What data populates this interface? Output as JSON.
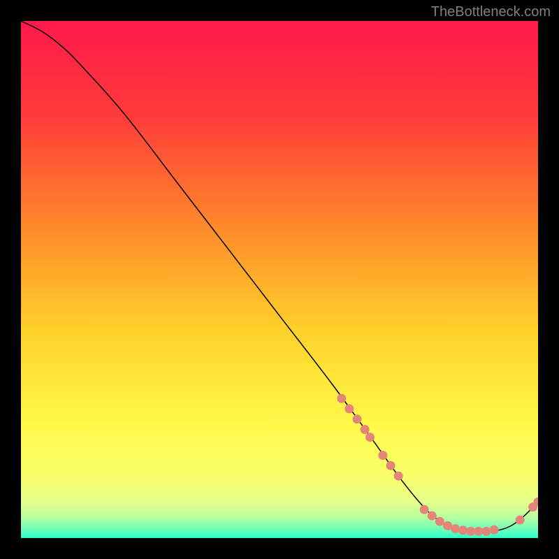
{
  "watermark": "TheBottleneck.com",
  "chart_data": {
    "type": "line",
    "title": "",
    "xlabel": "",
    "ylabel": "",
    "xlim": [
      0,
      100
    ],
    "ylim": [
      0,
      100
    ],
    "series": [
      {
        "name": "bottleneck-curve",
        "x": [
          0,
          4,
          8,
          12,
          20,
          30,
          40,
          50,
          60,
          68,
          73,
          77,
          80,
          83,
          86,
          90,
          94,
          97,
          100
        ],
        "y": [
          100,
          98,
          95,
          91,
          82,
          69,
          56,
          43,
          30,
          19,
          12,
          7,
          4,
          2.2,
          1.4,
          1.2,
          2.0,
          4,
          7
        ]
      }
    ],
    "points": [
      {
        "name": "cluster-descent",
        "x": 62,
        "y": 27
      },
      {
        "name": "cluster-descent",
        "x": 63.5,
        "y": 25
      },
      {
        "name": "cluster-descent",
        "x": 65,
        "y": 23
      },
      {
        "name": "cluster-descent",
        "x": 66.5,
        "y": 21
      },
      {
        "name": "cluster-descent",
        "x": 67.5,
        "y": 19.5
      },
      {
        "name": "cluster-descent",
        "x": 70,
        "y": 16
      },
      {
        "name": "cluster-descent",
        "x": 71.5,
        "y": 14
      },
      {
        "name": "cluster-descent",
        "x": 73,
        "y": 12
      },
      {
        "name": "cluster-trough",
        "x": 78,
        "y": 5.5
      },
      {
        "name": "cluster-trough",
        "x": 79.5,
        "y": 4.3
      },
      {
        "name": "cluster-trough",
        "x": 81,
        "y": 3.2
      },
      {
        "name": "cluster-trough",
        "x": 82.5,
        "y": 2.4
      },
      {
        "name": "cluster-trough",
        "x": 84,
        "y": 1.8
      },
      {
        "name": "cluster-trough",
        "x": 85.5,
        "y": 1.5
      },
      {
        "name": "cluster-trough",
        "x": 87,
        "y": 1.3
      },
      {
        "name": "cluster-trough",
        "x": 88.5,
        "y": 1.3
      },
      {
        "name": "cluster-trough",
        "x": 90,
        "y": 1.3
      },
      {
        "name": "cluster-trough",
        "x": 91.5,
        "y": 1.6
      },
      {
        "name": "cluster-rise",
        "x": 96.5,
        "y": 3.5
      },
      {
        "name": "cluster-rise",
        "x": 99,
        "y": 6
      },
      {
        "name": "cluster-rise",
        "x": 100,
        "y": 7
      }
    ],
    "gradient_stops": [
      {
        "offset": 0,
        "color": "#ff1a4a"
      },
      {
        "offset": 18,
        "color": "#ff3a3a"
      },
      {
        "offset": 40,
        "color": "#ff8a2a"
      },
      {
        "offset": 60,
        "color": "#ffd22a"
      },
      {
        "offset": 78,
        "color": "#fff94a"
      },
      {
        "offset": 88,
        "color": "#f9ff6a"
      },
      {
        "offset": 93,
        "color": "#e5ff8a"
      },
      {
        "offset": 96,
        "color": "#b8ffa0"
      },
      {
        "offset": 98,
        "color": "#7affb8"
      },
      {
        "offset": 100,
        "color": "#2affc8"
      }
    ]
  }
}
